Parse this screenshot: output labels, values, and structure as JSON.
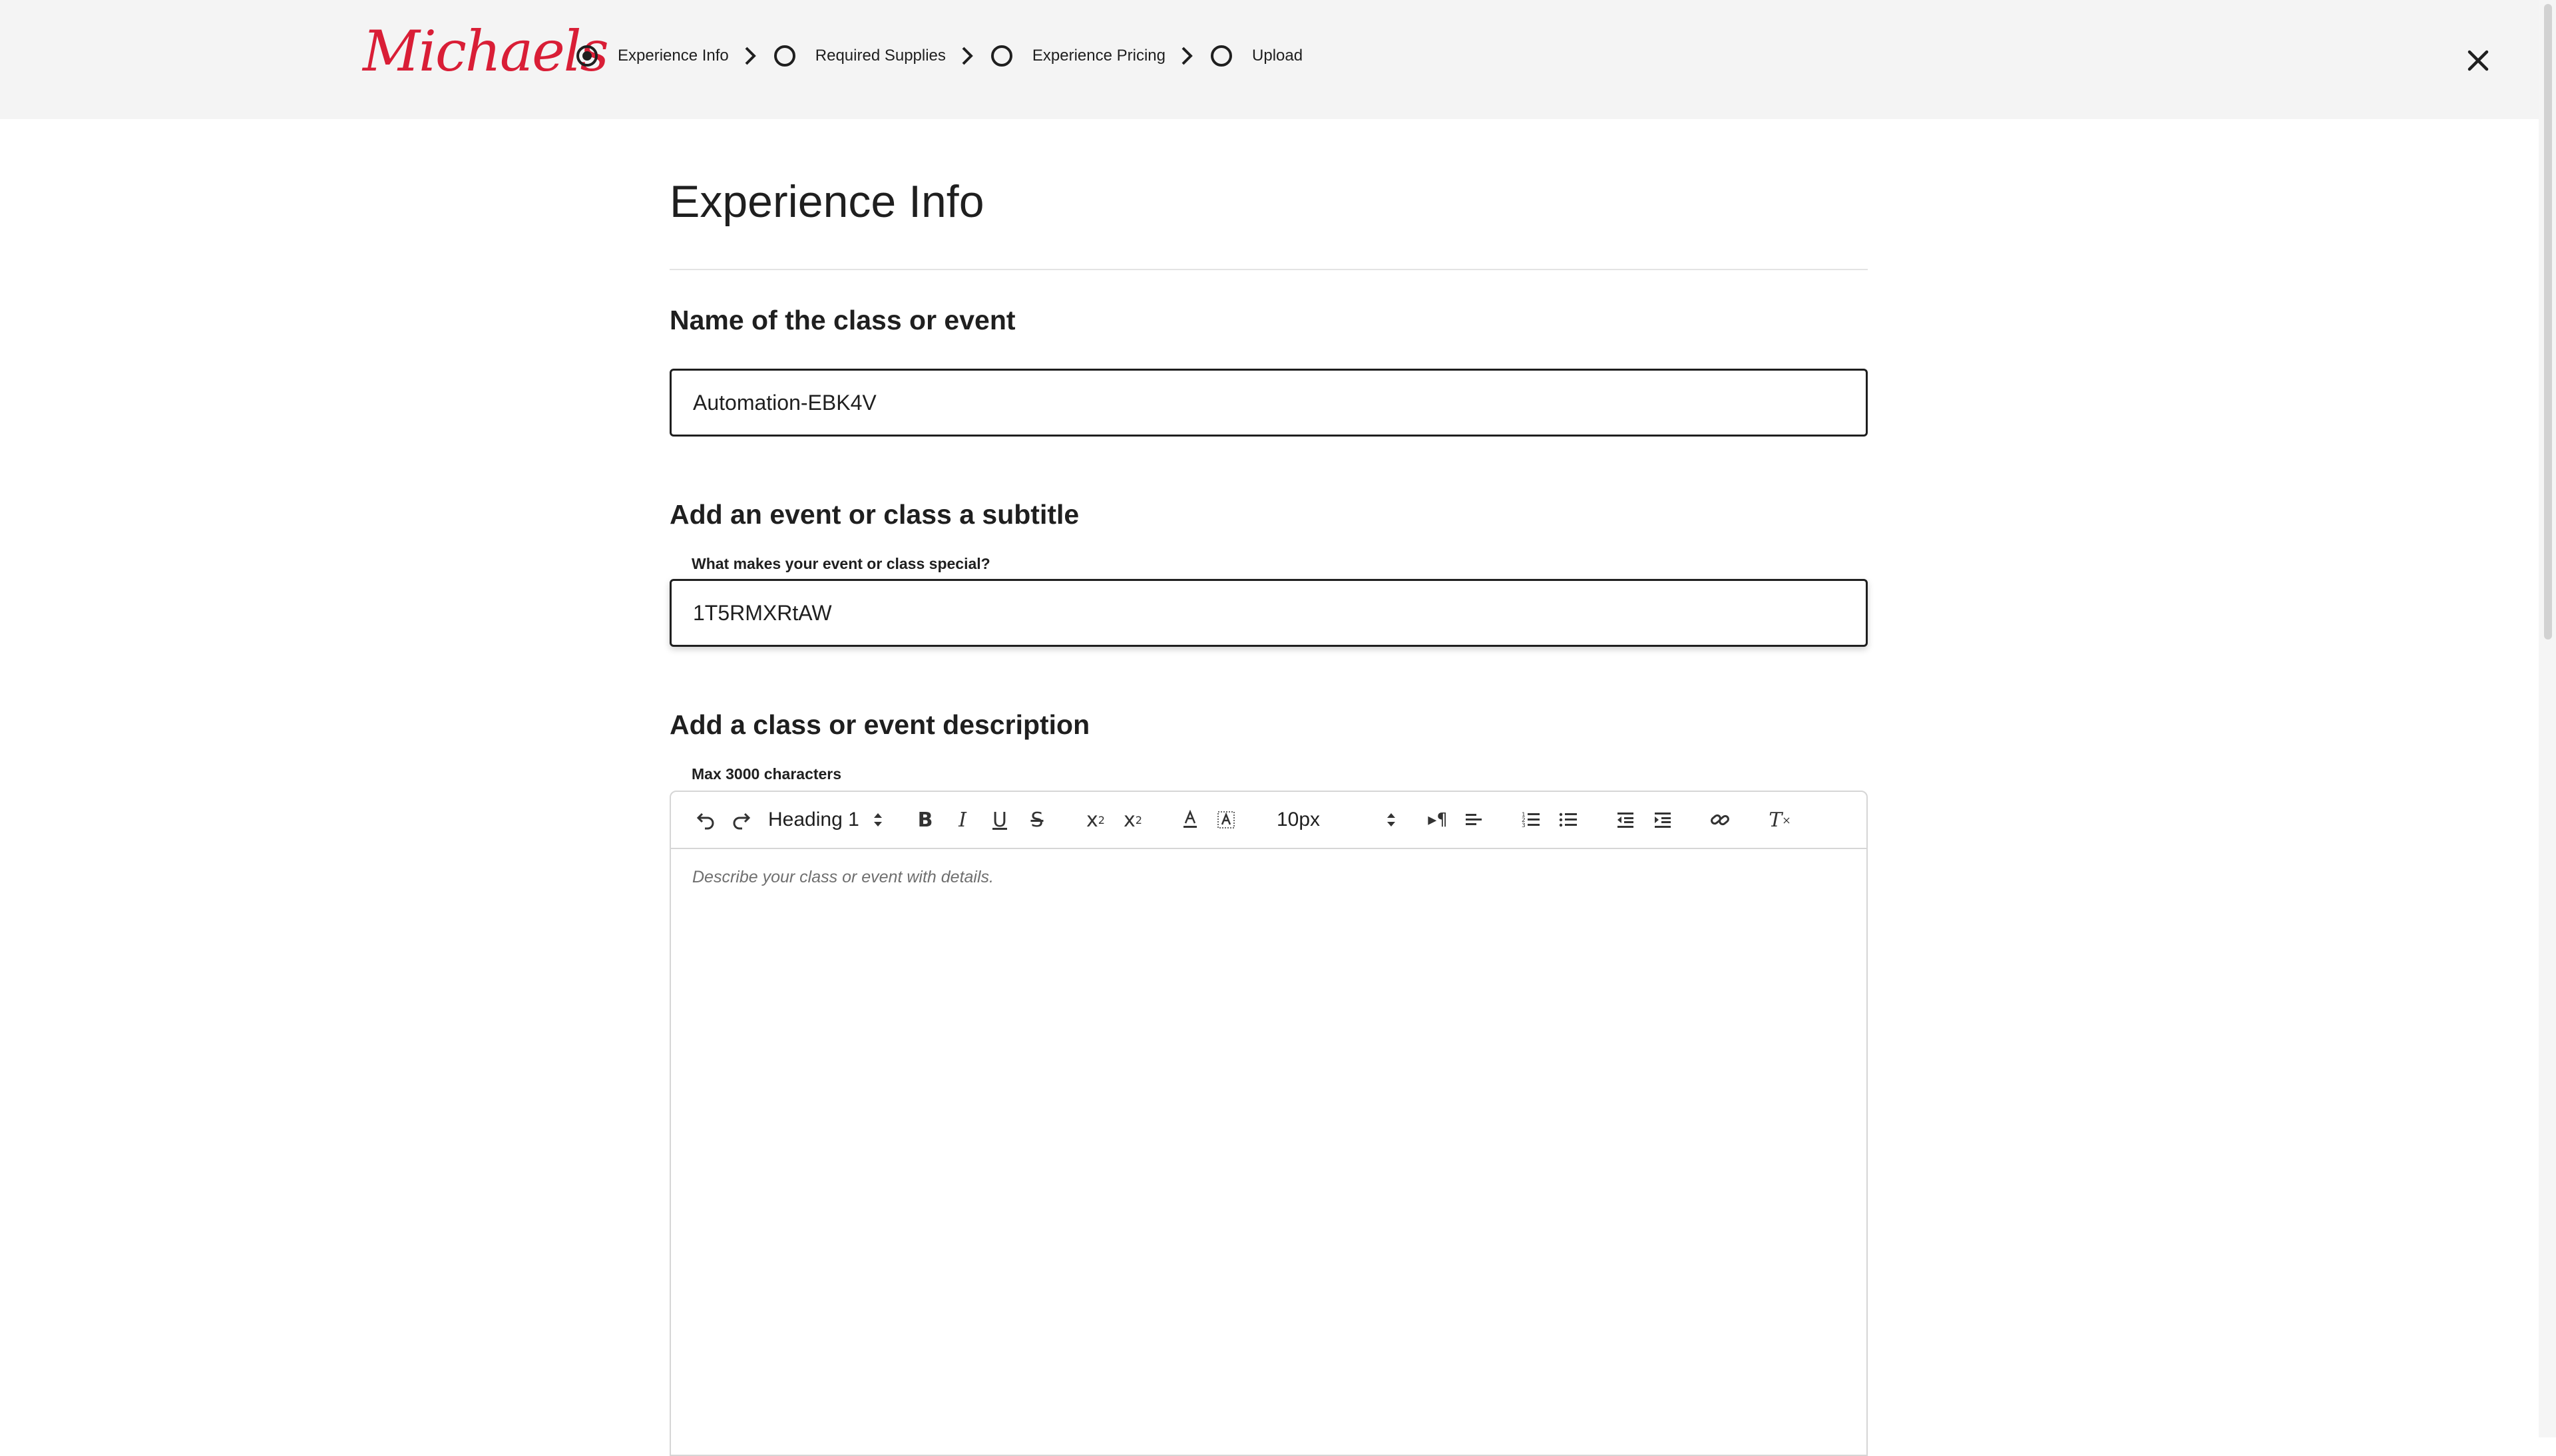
{
  "brand": {
    "logo_text": "Michaels",
    "color": "#d91e36"
  },
  "stepper": {
    "steps": [
      {
        "label": "Experience Info",
        "active": true
      },
      {
        "label": "Required Supplies",
        "active": false
      },
      {
        "label": "Experience Pricing",
        "active": false
      },
      {
        "label": "Upload",
        "active": false
      }
    ]
  },
  "header": {
    "close_icon": "close-icon"
  },
  "page": {
    "title": "Experience Info"
  },
  "name_section": {
    "heading": "Name of the class or event",
    "value": "Automation-EBK4V"
  },
  "subtitle_section": {
    "heading": "Add an event or class a subtitle",
    "label": "What makes your event or class special?",
    "value": "1T5RMXRtAW"
  },
  "description_section": {
    "heading": "Add a class or event description",
    "label": "Max 3000 characters",
    "placeholder": "Describe your class or event with details.",
    "toolbar": {
      "heading_select": "Heading 1",
      "font_size_select": "10px"
    }
  }
}
